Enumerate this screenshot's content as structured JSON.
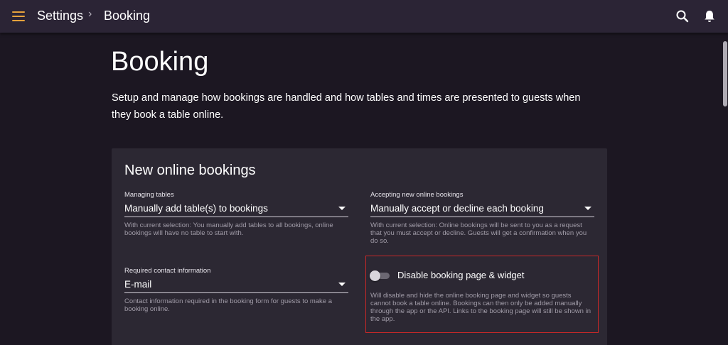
{
  "header": {
    "breadcrumb": [
      "Settings",
      "Booking"
    ],
    "separator": "›",
    "menu_icon": "hamburger-menu-icon",
    "search_icon": "search-icon",
    "notifications_icon": "bell-icon",
    "accent_color": "#e6a23c"
  },
  "page": {
    "title": "Booking",
    "description": "Setup and manage how bookings are handled and how tables and times are presented to guests when they book a table online."
  },
  "card": {
    "title": "New online bookings",
    "fields": [
      {
        "label": "Managing tables",
        "value": "Manually add table(s) to bookings",
        "hint": "With current selection: You manually add tables to all bookings, online bookings will have no table to start with."
      },
      {
        "label": "Accepting new online bookings",
        "value": "Manually accept or decline each booking",
        "hint": "With current selection: Online bookings will be sent to you as a request that you must accept or decline. Guests will get a confirmation when you do so."
      },
      {
        "label": "Required contact information",
        "value": "E-mail",
        "hint": "Contact information required in the booking form for guests to make a booking online."
      }
    ],
    "toggle": {
      "label": "Disable booking page & widget",
      "state": "off",
      "hint": "Will disable and hide the online booking page and widget so guests cannot book a table online. Bookings can then only be added manually through the app or the API. Links to the booking page will still be shown in the app.",
      "highlight_color": "#c62828"
    }
  }
}
